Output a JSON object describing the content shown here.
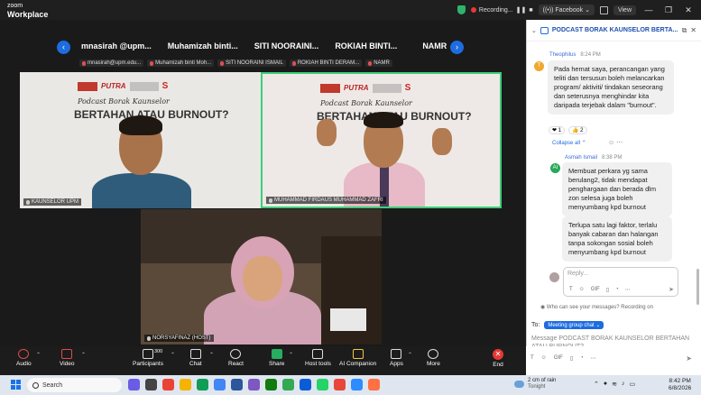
{
  "app": {
    "brand_line1": "zoom",
    "brand_line2": "Workplace"
  },
  "titlebar": {
    "recording_label": "Recording...",
    "facebook_label": "Facebook",
    "view_label": "View",
    "colors": {
      "shield": "#2fb36b",
      "record": "#e53935"
    }
  },
  "gallery": {
    "strip_names": [
      "mnasirah @upm...",
      "Muhamizah binti...",
      "SITI NOORAINI...",
      "ROKIAH BINTI...",
      "NAMR"
    ],
    "mini_labels": [
      "mnasirah@upm.edu...",
      "Muhamizah binti Moh...",
      "SITI NOORAINI ISMAIL",
      "ROKIAH BINTI DERAM...",
      "NAMR"
    ],
    "tiles": [
      {
        "name": "KAUNSELOR UPM"
      },
      {
        "name": "MUHAMMAD FIRDAUS MUHAMMAD ZAFRI"
      },
      {
        "name": "NORSYAFINAZ (HOST)"
      }
    ],
    "banner": {
      "putra": "PUTRA",
      "podcast": "Podcast Borak Kaunselor",
      "question": "BERTAHAN ATAU BURNOUT?"
    },
    "active_color": "#3ccf7a"
  },
  "chat": {
    "title": "PODCAST BORAK KAUNSELOR BERTA...",
    "messages": [
      {
        "sender": "Theophilus",
        "time": "8:24 PM",
        "avatar": "T",
        "text": "Pada hemat saya, perancangan yang teliti dan tersusun boleh melancarkan program/ aktiviti/ tindakan seseorang dan seterusnya menghindar kita daripada terjebak dalam \"burnout\".",
        "reactions": [
          "❤ 1",
          "👍 2"
        ]
      },
      {
        "sender": "Asmah Ismail",
        "time": "8:38 PM",
        "avatar": "AI",
        "text": "Membuat perkara yg sama berulang2, tidak mendapat penghargaan dan berada dlm zon selesa juga boleh menyumbang kpd burnout"
      },
      {
        "text": "Terlupa satu lagi faktor, terlalu banyak cabaran dan halangan tanpa sokongan sosial boleh menyumbang kpd burnout"
      }
    ],
    "collapse_label": "Collapse all",
    "reply_placeholder": "Reply...",
    "who_can_see": "Who can see your messages? Recording on",
    "to_label": "To:",
    "to_target": "Meeting group chat",
    "compose_placeholder": "Message PODCAST BORAK KAUNSELOR BERTAHAN ATAU BURNOUT?"
  },
  "toolbar": {
    "audio": "Audio",
    "video": "Video",
    "participants": "Participants",
    "participant_count": "300",
    "chat": "Chat",
    "react": "React",
    "share": "Share",
    "host_tools": "Host tools",
    "companion": "AI Companion",
    "apps": "Apps",
    "more": "More",
    "end": "End"
  },
  "taskbar": {
    "search": "Search",
    "weather_line1": "2 cm of rain",
    "weather_line2": "Tonight",
    "time": "8:42 PM",
    "date": "6/8/2026"
  }
}
